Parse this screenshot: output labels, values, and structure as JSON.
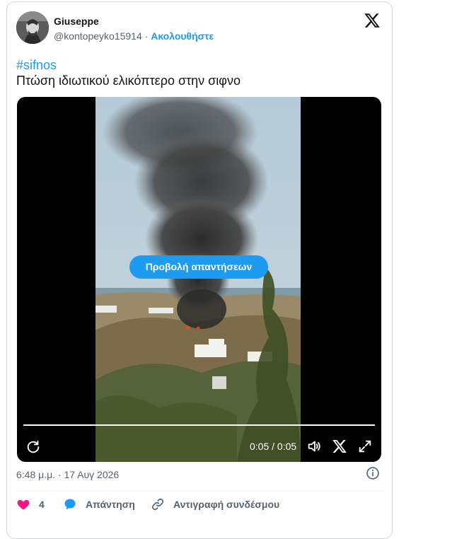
{
  "author": {
    "display_name": "Giuseppe",
    "handle": "@kontopeyko15914",
    "separator": " · ",
    "follow_label": "Ακολουθήστε"
  },
  "tweet": {
    "hashtag": "#sifnos",
    "text": "Πτώση ιδιωτικού ελικόπτερο στην σιφνο"
  },
  "video": {
    "replies_button_label": "Προβολή απαντήσεων",
    "time_display": "0:05 / 0:05",
    "progress_fraction": 1.0,
    "controls": [
      "replay-icon",
      "volume-icon",
      "x-logo-icon",
      "fullscreen-icon"
    ]
  },
  "meta": {
    "timestamp": "6:48 μ.μ. · 17 Αυγ 2026"
  },
  "actions": {
    "like_count": "4",
    "reply_label": "Απάντηση",
    "copy_link_label": "Αντιγραφή συνδέσμου"
  },
  "colors": {
    "accent": "#1d9bf0",
    "like": "#f91880",
    "text": "#0f1419",
    "muted": "#536471",
    "border": "#cfd9de"
  }
}
